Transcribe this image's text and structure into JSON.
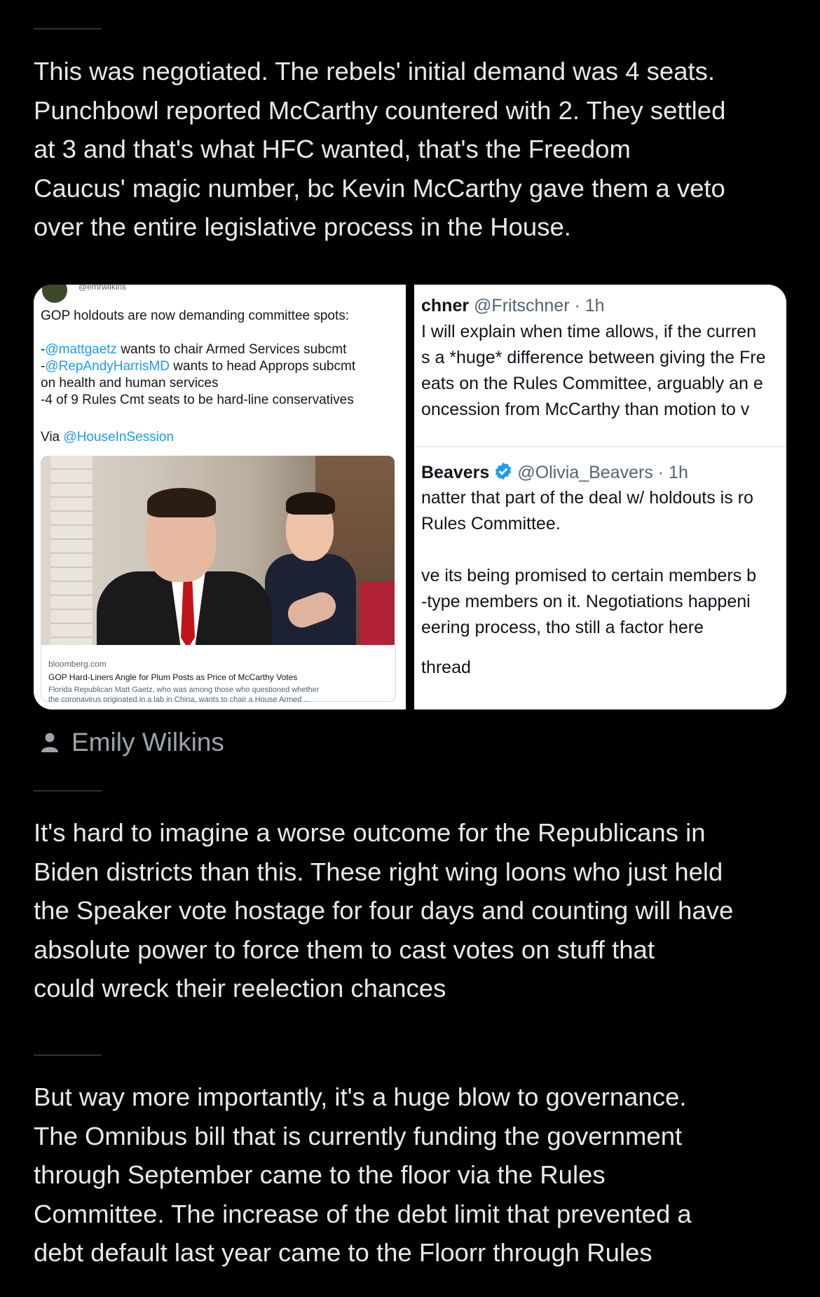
{
  "paragraphs": [
    {
      "lines": [
        "This was negotiated. The rebels' initial demand was 4 seats.",
        "Punchbowl reported McCarthy countered with 2. They settled",
        "at 3 and that's what HFC wanted, that's the Freedom",
        "Caucus' magic number, bc Kevin McCarthy  gave them a veto",
        "over the entire legislative process in the House."
      ]
    },
    {
      "lines": [
        "It's hard to imagine a worse outcome for the Republicans in",
        "Biden districts than this. These right wing loons who just held",
        "the Speaker vote hostage for four days and counting will have",
        "absolute power to force them to cast votes on stuff that",
        "could wreck their reelection chances"
      ]
    },
    {
      "lines": [
        "But way more importantly, it's a huge blow to governance.",
        "The Omnibus bill that is currently funding the government",
        "through September came to the floor via the Rules",
        "Committee. The increase of the debt limit that prevented a",
        "debt default last year came to the Floorr through Rules"
      ]
    }
  ],
  "image_attribution": {
    "icon": "person-icon",
    "name": "Emily Wilkins"
  },
  "embed": {
    "left_tweet": {
      "handle": "@emrwilkins",
      "heading": "GOP holdouts are now demanding committee spots:",
      "items": [
        {
          "prefix": "-",
          "mention": "@mattgaetz",
          "text": " wants to chair Armed Services subcmt"
        },
        {
          "prefix": "-",
          "mention": "@RepAndyHarrisMD",
          "text": " wants to head Approps subcmt"
        },
        {
          "prefix": "",
          "mention": "",
          "text": "on health and human services"
        },
        {
          "prefix": "",
          "mention": "",
          "text": "-4 of 9 Rules Cmt seats to be hard-line conservatives"
        }
      ],
      "via_label": "Via ",
      "via_mention": "@HouseInSession",
      "card": {
        "domain": "bloomberg.com",
        "title": "GOP Hard-Liners Angle for Plum Posts as Price of McCarthy Votes",
        "desc_line1": "Florida Republican Matt Gaetz, who was among those who questioned whether",
        "desc_line2": "the coronavirus originated in a lab in China, wants to chair a House Armed ..."
      }
    },
    "right_tweet": {
      "first": {
        "name_fragment": "chner",
        "handle_time": "@Fritschner · 1h",
        "lines": [
          "I will explain when time allows, if the curren",
          "s a *huge* difference between giving the Fre",
          "eats on the Rules Committee, arguably an e",
          "oncession from McCarthy than motion to v"
        ]
      },
      "second": {
        "name_fragment": "Beavers",
        "handle_time": "@Olivia_Beavers · 1h",
        "lines": [
          "natter that part of the deal w/ holdouts is ro",
          "Rules Committee.",
          "",
          "ve its being promised to certain members b",
          "-type members on it. Negotiations happeni",
          "eering process, tho still a factor here"
        ],
        "link": "thread"
      }
    }
  }
}
